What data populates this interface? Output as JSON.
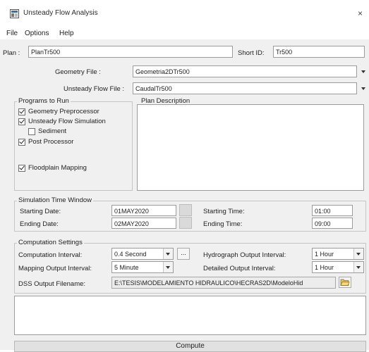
{
  "window": {
    "title": "Unsteady Flow Analysis",
    "app_icon": "hecras-app-icon",
    "close_glyph": "×"
  },
  "menu": [
    "File",
    "Options",
    "Help"
  ],
  "plan": {
    "label": "Plan :",
    "value": "PlanTr500",
    "short_id_label": "Short ID:",
    "short_id_value": "Tr500"
  },
  "geometry_file": {
    "label": "Geometry File :",
    "value": "Geometria2DTr500"
  },
  "unsteady_flow_file": {
    "label": "Unsteady Flow File :",
    "value": "CaudalTr500"
  },
  "programs": {
    "title": "Programs to Run",
    "items": [
      {
        "label": "Geometry Preprocessor",
        "checked": true
      },
      {
        "label": "Unsteady Flow Simulation",
        "checked": true
      },
      {
        "label": "Sediment",
        "checked": false
      },
      {
        "label": "Post Processor",
        "checked": true
      },
      {
        "label": "Floodplain Mapping",
        "checked": true
      }
    ]
  },
  "plan_description": {
    "title": "Plan Description",
    "text": ""
  },
  "simulation_window": {
    "title": "Simulation Time Window",
    "starting_date_label": "Starting Date:",
    "starting_date": "01MAY2020",
    "ending_date_label": "Ending Date:",
    "ending_date": "02MAY2020",
    "starting_time_label": "Starting Time:",
    "starting_time": "01:00",
    "ending_time_label": "Ending Time:",
    "ending_time": "09:00"
  },
  "computation": {
    "title": "Computation Settings",
    "computation_interval_label": "Computation Interval:",
    "computation_interval": "0.4 Second",
    "more_button": "...",
    "hydrograph_interval_label": "Hydrograph Output Interval:",
    "hydrograph_interval": "1 Hour",
    "mapping_interval_label": "Mapping Output Interval:",
    "mapping_interval": "5 Minute",
    "detailed_interval_label": "Detailed Output Interval:",
    "detailed_interval": "1 Hour",
    "dss_label": "DSS Output Filename:",
    "dss_value": "E:\\TESIS\\MODELAMIENTO HIDRAULICO\\HECRAS2D\\ModeloHid"
  },
  "log_text": "",
  "compute_button": "Compute"
}
